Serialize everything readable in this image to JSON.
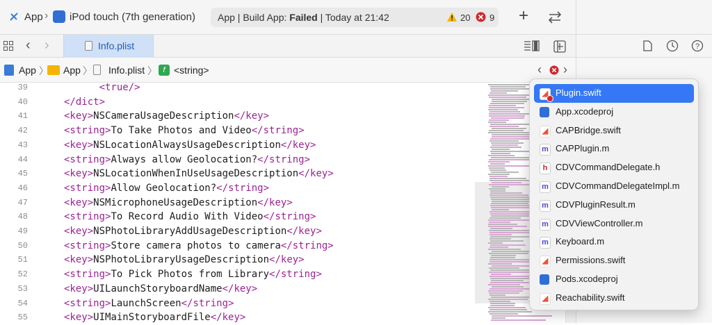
{
  "toolbar": {
    "scheme": "App",
    "device": "iPod touch (7th generation)",
    "status_prefix": "App | Build App: ",
    "status_result": "Failed",
    "status_suffix": " | Today at 21:42",
    "warning_count": "20",
    "error_count": "9",
    "add_label": "+"
  },
  "tab": {
    "active_label": "Info.plist"
  },
  "jumpbar": {
    "crumbs": [
      "App",
      "App",
      "Info.plist",
      "<string>"
    ]
  },
  "editor": {
    "lines": [
      {
        "n": "39",
        "indent": "      ",
        "open": "<true/>",
        "text": "",
        "close": ""
      },
      {
        "n": "40",
        "indent": "",
        "open": "</dict>",
        "text": "",
        "close": ""
      },
      {
        "n": "41",
        "indent": "",
        "open": "<key>",
        "text": "NSCameraUsageDescription",
        "close": "</key>"
      },
      {
        "n": "42",
        "indent": "",
        "open": "<string>",
        "text": "To Take Photos and Video",
        "close": "</string>"
      },
      {
        "n": "43",
        "indent": "",
        "open": "<key>",
        "text": "NSLocationAlwaysUsageDescription",
        "close": "</key>"
      },
      {
        "n": "44",
        "indent": "",
        "open": "<string>",
        "text": "Always allow Geolocation?",
        "close": "</string>"
      },
      {
        "n": "45",
        "indent": "",
        "open": "<key>",
        "text": "NSLocationWhenInUseUsageDescription",
        "close": "</key>"
      },
      {
        "n": "46",
        "indent": "",
        "open": "<string>",
        "text": "Allow Geolocation?",
        "close": "</string>"
      },
      {
        "n": "47",
        "indent": "",
        "open": "<key>",
        "text": "NSMicrophoneUsageDescription",
        "close": "</key>"
      },
      {
        "n": "48",
        "indent": "",
        "open": "<string>",
        "text": "To Record Audio With Video",
        "close": "</string>"
      },
      {
        "n": "49",
        "indent": "",
        "open": "<key>",
        "text": "NSPhotoLibraryAddUsageDescription",
        "close": "</key>"
      },
      {
        "n": "50",
        "indent": "",
        "open": "<string>",
        "text": "Store camera photos to camera",
        "close": "</string>"
      },
      {
        "n": "51",
        "indent": "",
        "open": "<key>",
        "text": "NSPhotoLibraryUsageDescription",
        "close": "</key>"
      },
      {
        "n": "52",
        "indent": "",
        "open": "<string>",
        "text": "To Pick Photos from Library",
        "close": "</string>"
      },
      {
        "n": "53",
        "indent": "",
        "open": "<key>",
        "text": "UILaunchStoryboardName",
        "close": "</key>"
      },
      {
        "n": "54",
        "indent": "",
        "open": "<string>",
        "text": "LaunchScreen",
        "close": "</string>"
      },
      {
        "n": "55",
        "indent": "",
        "open": "<key>",
        "text": "UIMainStoryboardFile",
        "close": "</key>"
      }
    ]
  },
  "popup": {
    "items": [
      {
        "label": "Plugin.swift",
        "icon": "swift-file-icon",
        "selected": true
      },
      {
        "label": "App.xcodeproj",
        "icon": "xcodeproj-icon"
      },
      {
        "label": "CAPBridge.swift",
        "icon": "swift-file-icon"
      },
      {
        "label": "CAPPlugin.m",
        "icon": "objc-m-file-icon"
      },
      {
        "label": "CDVCommandDelegate.h",
        "icon": "header-h-file-icon"
      },
      {
        "label": "CDVCommandDelegateImpl.m",
        "icon": "objc-m-file-icon"
      },
      {
        "label": "CDVPluginResult.m",
        "icon": "objc-m-file-icon"
      },
      {
        "label": "CDVViewController.m",
        "icon": "objc-m-file-icon"
      },
      {
        "label": "Keyboard.m",
        "icon": "objc-m-file-icon"
      },
      {
        "label": "Permissions.swift",
        "icon": "swift-file-icon"
      },
      {
        "label": "Pods.xcodeproj",
        "icon": "xcodeproj-icon"
      },
      {
        "label": "Reachability.swift",
        "icon": "swift-file-icon"
      }
    ]
  },
  "colors": {
    "accent": "#3478f6",
    "xml_tag": "#9b2393",
    "error": "#d0272d",
    "warning": "#f5b400",
    "tab_active": "#cfe0f7"
  }
}
